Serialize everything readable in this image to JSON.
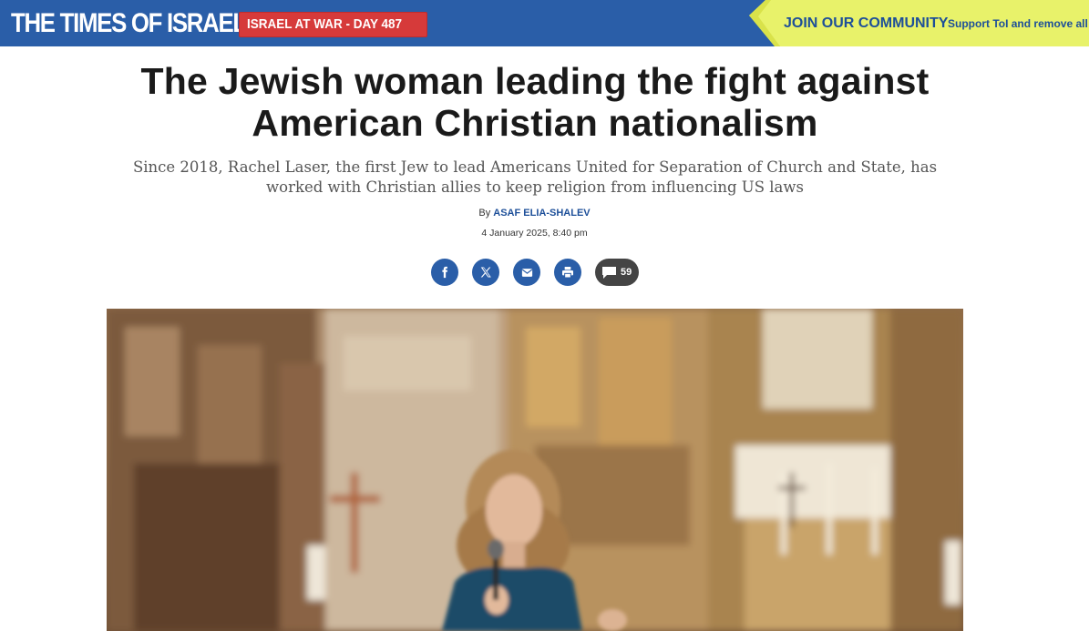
{
  "header": {
    "logo": "THE TIMES OF ISRAEL",
    "war_badge": "ISRAEL AT WAR - DAY 487",
    "community_cta": "JOIN OUR COMMUNITY",
    "community_sub": "Support ToI and remove all a"
  },
  "article": {
    "headline_line1": "The Jewish woman leading the fight against",
    "headline_line2": "American Christian nationalism",
    "subhead": "Since 2018, Rachel Laser, the first Jew to lead Americans United for Separation of Church and State, has worked with Christian allies to keep religion from influencing US laws",
    "by_label": "By",
    "author": "ASAF ELIA-SHALEV",
    "date": "4 January 2025, 8:40 pm"
  },
  "share": {
    "facebook_icon": "facebook-icon",
    "x_icon": "x-icon",
    "email_icon": "email-icon",
    "print_icon": "print-icon",
    "comments_icon": "comment-icon",
    "comments_count": "59"
  },
  "colors": {
    "brand_blue": "#2a5ea8",
    "war_red": "#d63a3a",
    "community_yellow": "#e8f26a",
    "link_blue": "#1d4f99",
    "comments_gray": "#444444"
  }
}
